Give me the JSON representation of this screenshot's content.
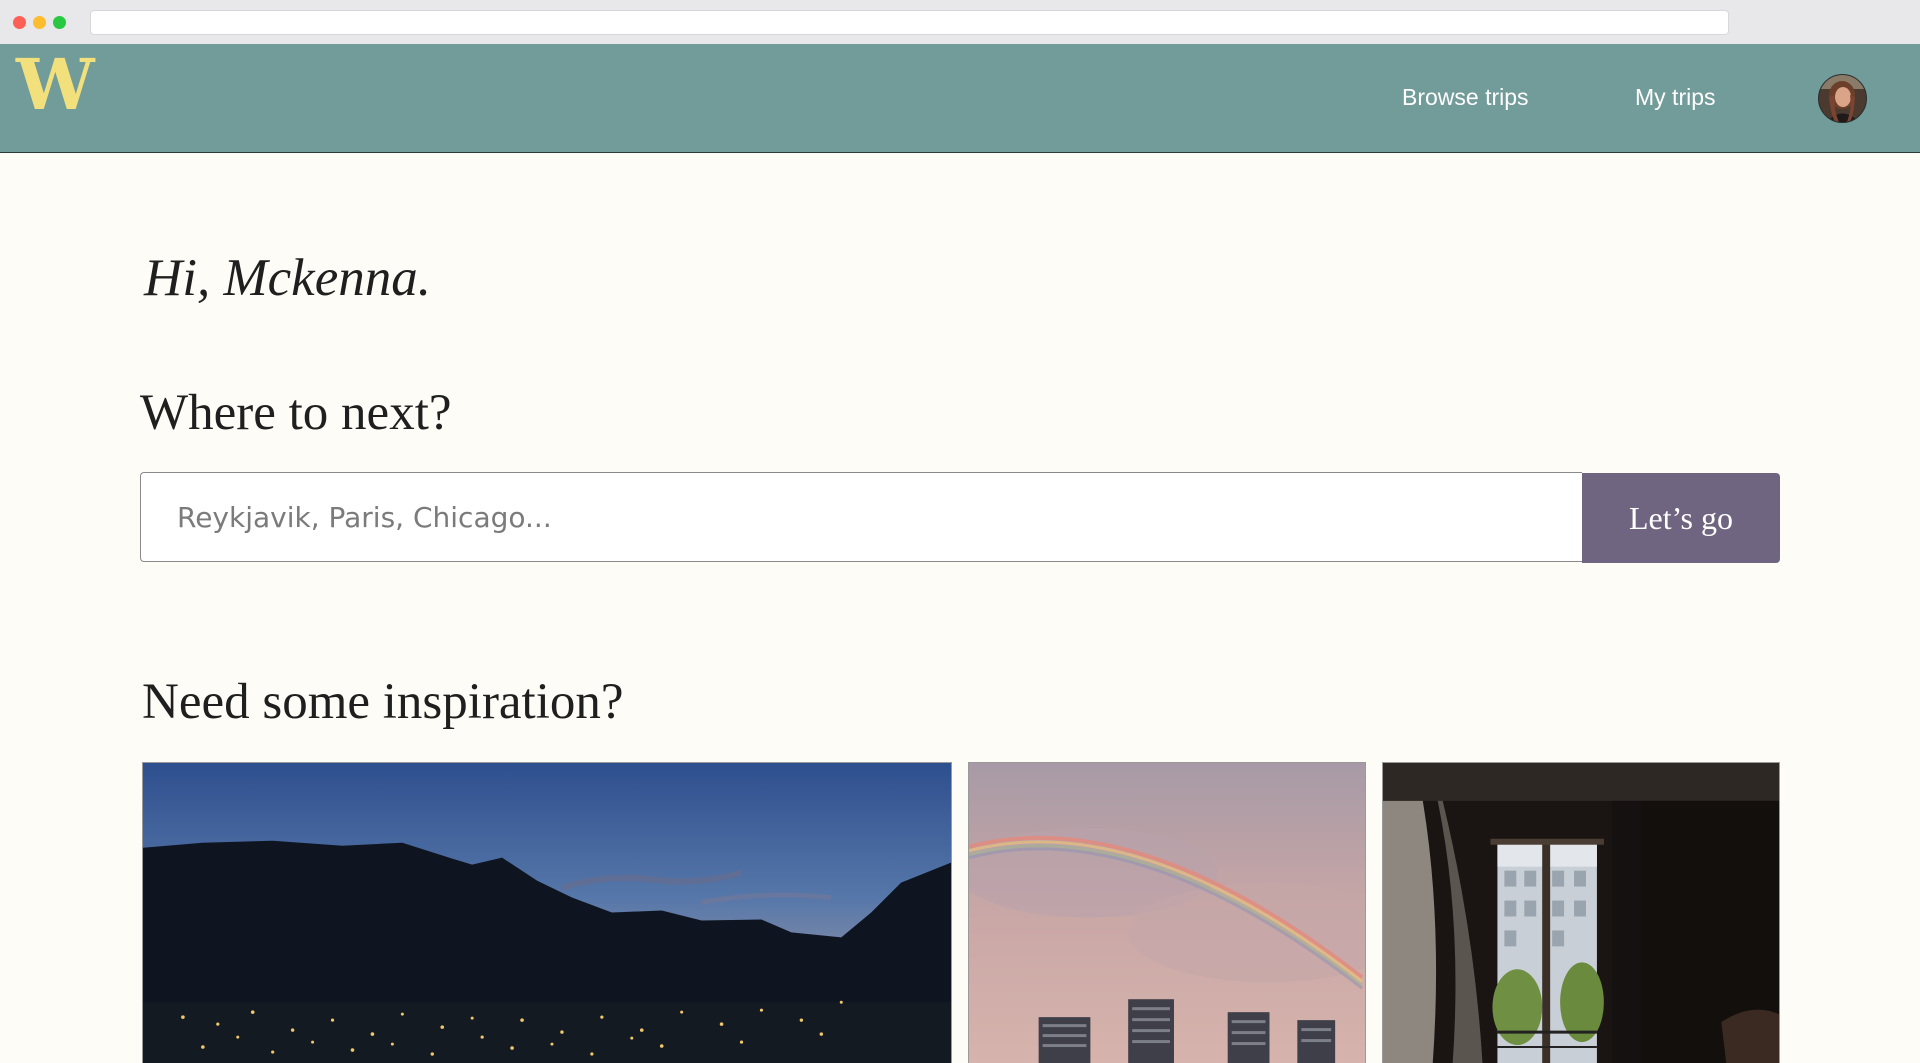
{
  "header": {
    "logo": "W",
    "nav": {
      "browse_trips": "Browse trips",
      "my_trips": "My trips"
    }
  },
  "main": {
    "greeting": "Hi, Mckenna.",
    "search_title": "Where to next?",
    "search": {
      "placeholder": "Reykjavik, Paris, Chicago...",
      "value": "",
      "button_label": "Let’s go"
    },
    "inspiration_title": "Need some inspiration?",
    "cards": [
      {
        "image": "mountain-valley-night-photo"
      },
      {
        "image": "rainbow-city-skyline-photo"
      },
      {
        "image": "hotel-window-view-photo"
      }
    ]
  },
  "colors": {
    "header_bg": "#729c9a",
    "logo": "#f2e07c",
    "button_bg": "#6f6580",
    "page_bg": "#fdfcf7"
  }
}
